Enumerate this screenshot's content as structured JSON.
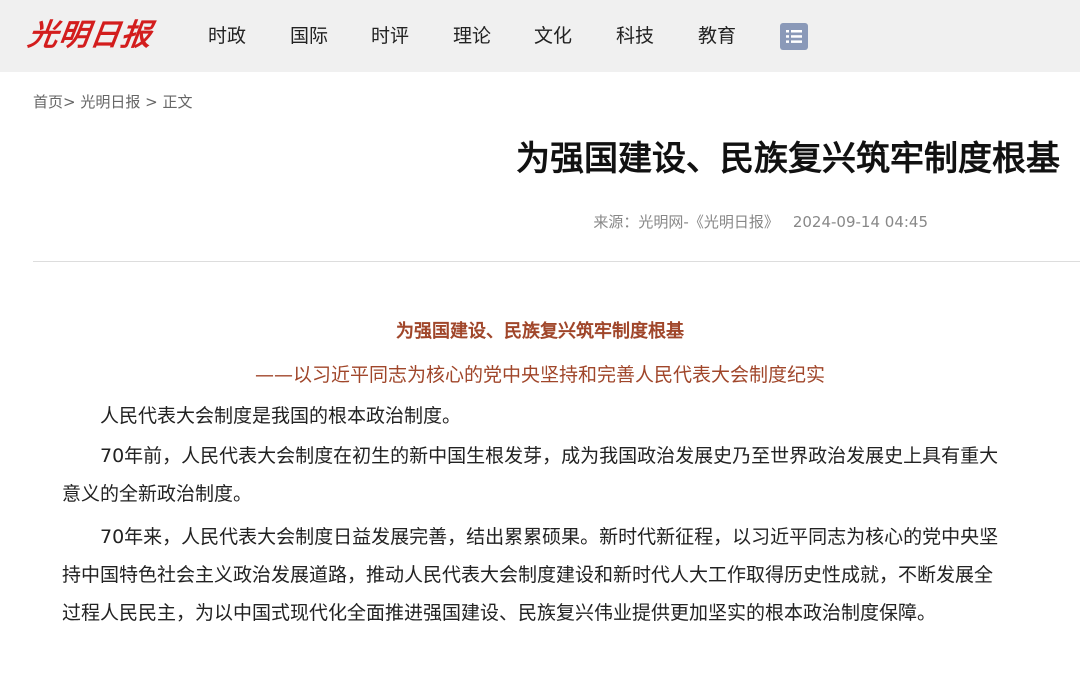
{
  "header": {
    "logo_text": "光明日报",
    "nav": [
      {
        "label": "时政"
      },
      {
        "label": "国际"
      },
      {
        "label": "时评"
      },
      {
        "label": "理论"
      },
      {
        "label": "文化"
      },
      {
        "label": "科技"
      },
      {
        "label": "教育"
      }
    ],
    "menu_icon": "list-menu-icon"
  },
  "breadcrumb": {
    "home": "首页",
    "sep1": ">",
    "section": "光明日报",
    "sep2": ">",
    "current": "正文"
  },
  "article": {
    "title": "为强国建设、民族复兴筑牢制度根基",
    "source": "来源：光明网-《光明日报》",
    "datetime": "2024-09-14 04:45",
    "subtitle": "为强国建设、民族复兴筑牢制度根基",
    "subtitle2": "——以习近平同志为核心的党中央坚持和完善人民代表大会制度纪实",
    "paragraphs": [
      "人民代表大会制度是我国的根本政治制度。",
      "70年前，人民代表大会制度在初生的新中国生根发芽，成为我国政治发展史乃至世界政治发展史上具有重大意义的全新政治制度。",
      "70年来，人民代表大会制度日益发展完善，结出累累硕果。新时代新征程，以习近平同志为核心的党中央坚持中国特色社会主义政治发展道路，推动人民代表大会制度建设和新时代人大工作取得历史性成就，不断发展全过程人民民主，为以中国式现代化全面推进强国建设、民族复兴伟业提供更加坚实的根本政治制度保障。"
    ]
  },
  "colors": {
    "logo_red": "#d31d1d",
    "subtitle_brown": "#a0462a",
    "menu_icon_bg": "#8a99b8",
    "topbar_bg": "#f0f0f0"
  }
}
